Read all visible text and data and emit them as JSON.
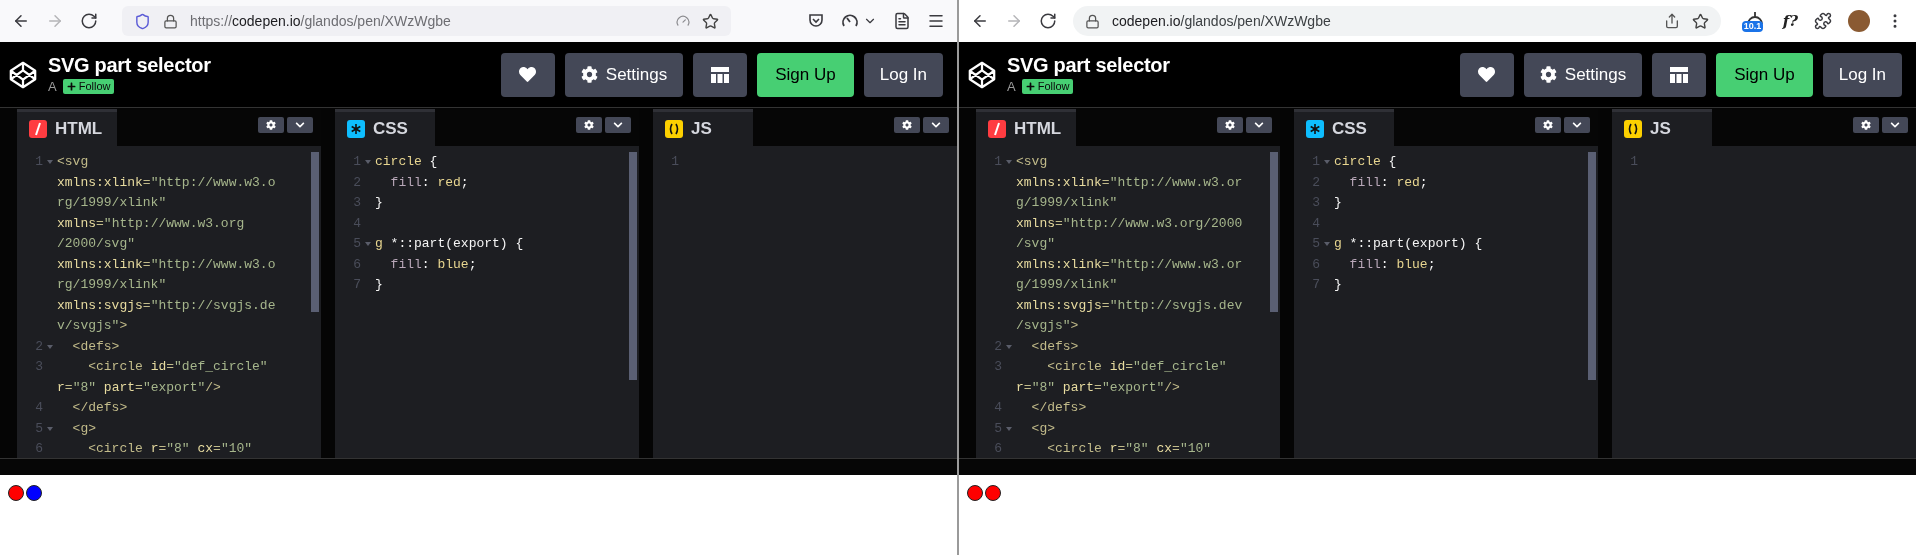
{
  "windows": [
    {
      "browser": {
        "kind": "firefox",
        "forward_disabled": true,
        "url": {
          "prefix": "https://",
          "host": "codepen.io",
          "path": "/glandos/pen/XWzWgbe"
        }
      },
      "pen": {
        "title": "SVG part selector",
        "author": "A",
        "follow": "Follow",
        "buttons": [
          {
            "kind": "heart"
          },
          {
            "kind": "settings",
            "label": "Settings"
          },
          {
            "kind": "layout"
          },
          {
            "kind": "signup",
            "label": "Sign Up"
          },
          {
            "kind": "login",
            "label": "Log In"
          }
        ]
      },
      "editors": [
        {
          "kind": "html",
          "label": "HTML",
          "lines": [
            {
              "n": "1",
              "fold": true,
              "seg": [
                {
                  "text": "<svg",
                  "kind": "t"
                }
              ]
            },
            {
              "seg": [
                {
                  "text": "xmlns:xlink",
                  "kind": "a"
                },
                {
                  "text": "=",
                  "kind": "t"
                },
                {
                  "text": "\"http://www.w3.o",
                  "kind": "s"
                }
              ]
            },
            {
              "seg": [
                {
                  "text": "rg/1999/xlink\"",
                  "kind": "s"
                }
              ]
            },
            {
              "seg": [
                {
                  "text": "xmlns",
                  "kind": "a"
                },
                {
                  "text": "=",
                  "kind": "t"
                },
                {
                  "text": "\"http://www.w3.org",
                  "kind": "s"
                }
              ]
            },
            {
              "seg": [
                {
                  "text": "/2000/svg\"",
                  "kind": "s"
                }
              ]
            },
            {
              "seg": [
                {
                  "text": "xmlns:xlink",
                  "kind": "a"
                },
                {
                  "text": "=",
                  "kind": "t"
                },
                {
                  "text": "\"http://www.w3.o",
                  "kind": "s"
                }
              ]
            },
            {
              "seg": [
                {
                  "text": "rg/1999/xlink\"",
                  "kind": "s"
                }
              ]
            },
            {
              "seg": [
                {
                  "text": "xmlns:svgjs",
                  "kind": "a"
                },
                {
                  "text": "=",
                  "kind": "t"
                },
                {
                  "text": "\"http://svgjs.de",
                  "kind": "s"
                }
              ]
            },
            {
              "seg": [
                {
                  "text": "v/svgjs\"",
                  "kind": "s"
                },
                {
                  "text": ">",
                  "kind": "t"
                }
              ]
            },
            {
              "n": "2",
              "fold": true,
              "seg": [
                {
                  "text": "  <defs>",
                  "kind": "t"
                }
              ]
            },
            {
              "n": "3",
              "fold": false,
              "seg": [
                {
                  "text": "    <circle ",
                  "kind": "t"
                },
                {
                  "text": "id",
                  "kind": "a"
                },
                {
                  "text": "=",
                  "kind": "t"
                },
                {
                  "text": "\"def_circle\"",
                  "kind": "s"
                }
              ]
            },
            {
              "seg": [
                {
                  "text": "r",
                  "kind": "a"
                },
                {
                  "text": "=",
                  "kind": "t"
                },
                {
                  "text": "\"8\" ",
                  "kind": "s"
                },
                {
                  "text": "part",
                  "kind": "a"
                },
                {
                  "text": "=",
                  "kind": "t"
                },
                {
                  "text": "\"export\"",
                  "kind": "s"
                },
                {
                  "text": "/>",
                  "kind": "t"
                }
              ]
            },
            {
              "n": "4",
              "fold": false,
              "seg": [
                {
                  "text": "  </defs>",
                  "kind": "t"
                }
              ]
            },
            {
              "n": "5",
              "fold": true,
              "seg": [
                {
                  "text": "  <g>",
                  "kind": "t"
                }
              ]
            },
            {
              "n": "6",
              "fold": false,
              "seg": [
                {
                  "text": "    <circle ",
                  "kind": "t"
                },
                {
                  "text": "r",
                  "kind": "a"
                },
                {
                  "text": "=",
                  "kind": "t"
                },
                {
                  "text": "\"8\" ",
                  "kind": "s"
                },
                {
                  "text": "cx",
                  "kind": "a"
                },
                {
                  "text": "=",
                  "kind": "t"
                },
                {
                  "text": "\"10\"",
                  "kind": "s"
                }
              ]
            }
          ]
        },
        {
          "kind": "css",
          "label": "CSS",
          "lines": [
            {
              "n": "1",
              "fold": true,
              "seg": [
                {
                  "text": "circle",
                  "kind": "sel"
                },
                {
                  "text": " {",
                  "kind": "p"
                }
              ]
            },
            {
              "n": "2",
              "fold": false,
              "seg": [
                {
                  "text": "  fill",
                  "kind": "prop"
                },
                {
                  "text": ": ",
                  "kind": "p"
                },
                {
                  "text": "red",
                  "kind": "val"
                },
                {
                  "text": ";",
                  "kind": "p"
                }
              ]
            },
            {
              "n": "3",
              "fold": false,
              "seg": [
                {
                  "text": "}",
                  "kind": "p"
                }
              ]
            },
            {
              "n": "4",
              "fold": false
            },
            {
              "n": "5",
              "fold": true,
              "seg": [
                {
                  "text": "g",
                  "kind": "sel"
                },
                {
                  "text": " *::part(export) {",
                  "kind": "p"
                }
              ]
            },
            {
              "n": "6",
              "fold": false,
              "seg": [
                {
                  "text": "  fill",
                  "kind": "prop"
                },
                {
                  "text": ": ",
                  "kind": "p"
                },
                {
                  "text": "blue",
                  "kind": "val"
                },
                {
                  "text": ";",
                  "kind": "p"
                }
              ]
            },
            {
              "n": "7",
              "fold": false,
              "seg": [
                {
                  "text": "}",
                  "kind": "p"
                }
              ]
            }
          ]
        },
        {
          "kind": "js",
          "label": "JS",
          "lines": [
            {
              "n": "1",
              "fold": false
            }
          ]
        }
      ],
      "preview": {
        "circles": [
          {
            "color": "#ff0000"
          },
          {
            "color": "#0000ff"
          }
        ]
      }
    },
    {
      "browser": {
        "kind": "chrome",
        "forward_disabled": true,
        "url": {
          "host": "codepen.io",
          "path": "/glandos/pen/XWzWgbe"
        },
        "extension_badge": "10.1",
        "extension_text": "f?"
      },
      "pen": {
        "title": "SVG part selector",
        "author": "A",
        "follow": "Follow",
        "buttons": [
          {
            "kind": "heart"
          },
          {
            "kind": "settings",
            "label": "Settings"
          },
          {
            "kind": "layout"
          },
          {
            "kind": "signup",
            "label": "Sign Up"
          },
          {
            "kind": "login",
            "label": "Log In"
          }
        ]
      },
      "editors": [
        {
          "kind": "html",
          "label": "HTML",
          "lines": [
            {
              "n": "1",
              "fold": true,
              "seg": [
                {
                  "text": "<svg",
                  "kind": "t"
                }
              ]
            },
            {
              "seg": [
                {
                  "text": "xmlns:xlink",
                  "kind": "a"
                },
                {
                  "text": "=",
                  "kind": "t"
                },
                {
                  "text": "\"http://www.w3.or",
                  "kind": "s"
                }
              ]
            },
            {
              "seg": [
                {
                  "text": "g/1999/xlink\"",
                  "kind": "s"
                }
              ]
            },
            {
              "seg": [
                {
                  "text": "xmlns",
                  "kind": "a"
                },
                {
                  "text": "=",
                  "kind": "t"
                },
                {
                  "text": "\"http://www.w3.org/2000",
                  "kind": "s"
                }
              ]
            },
            {
              "seg": [
                {
                  "text": "/svg\"",
                  "kind": "s"
                }
              ]
            },
            {
              "seg": [
                {
                  "text": "xmlns:xlink",
                  "kind": "a"
                },
                {
                  "text": "=",
                  "kind": "t"
                },
                {
                  "text": "\"http://www.w3.or",
                  "kind": "s"
                }
              ]
            },
            {
              "seg": [
                {
                  "text": "g/1999/xlink\"",
                  "kind": "s"
                }
              ]
            },
            {
              "seg": [
                {
                  "text": "xmlns:svgjs",
                  "kind": "a"
                },
                {
                  "text": "=",
                  "kind": "t"
                },
                {
                  "text": "\"http://svgjs.dev",
                  "kind": "s"
                }
              ]
            },
            {
              "seg": [
                {
                  "text": "/svgjs\"",
                  "kind": "s"
                },
                {
                  "text": ">",
                  "kind": "t"
                }
              ]
            },
            {
              "n": "2",
              "fold": true,
              "seg": [
                {
                  "text": "  <defs>",
                  "kind": "t"
                }
              ]
            },
            {
              "n": "3",
              "fold": false,
              "seg": [
                {
                  "text": "    <circle ",
                  "kind": "t"
                },
                {
                  "text": "id",
                  "kind": "a"
                },
                {
                  "text": "=",
                  "kind": "t"
                },
                {
                  "text": "\"def_circle\"",
                  "kind": "s"
                }
              ]
            },
            {
              "seg": [
                {
                  "text": "r",
                  "kind": "a"
                },
                {
                  "text": "=",
                  "kind": "t"
                },
                {
                  "text": "\"8\" ",
                  "kind": "s"
                },
                {
                  "text": "part",
                  "kind": "a"
                },
                {
                  "text": "=",
                  "kind": "t"
                },
                {
                  "text": "\"export\"",
                  "kind": "s"
                },
                {
                  "text": "/>",
                  "kind": "t"
                }
              ]
            },
            {
              "n": "4",
              "fold": false,
              "seg": [
                {
                  "text": "  </defs>",
                  "kind": "t"
                }
              ]
            },
            {
              "n": "5",
              "fold": true,
              "seg": [
                {
                  "text": "  <g>",
                  "kind": "t"
                }
              ]
            },
            {
              "n": "6",
              "fold": false,
              "seg": [
                {
                  "text": "    <circle ",
                  "kind": "t"
                },
                {
                  "text": "r",
                  "kind": "a"
                },
                {
                  "text": "=",
                  "kind": "t"
                },
                {
                  "text": "\"8\" ",
                  "kind": "s"
                },
                {
                  "text": "cx",
                  "kind": "a"
                },
                {
                  "text": "=",
                  "kind": "t"
                },
                {
                  "text": "\"10\"",
                  "kind": "s"
                }
              ]
            }
          ]
        },
        {
          "kind": "css",
          "label": "CSS",
          "lines": [
            {
              "n": "1",
              "fold": true,
              "seg": [
                {
                  "text": "circle",
                  "kind": "sel"
                },
                {
                  "text": " {",
                  "kind": "p"
                }
              ]
            },
            {
              "n": "2",
              "fold": false,
              "seg": [
                {
                  "text": "  fill",
                  "kind": "prop"
                },
                {
                  "text": ": ",
                  "kind": "p"
                },
                {
                  "text": "red",
                  "kind": "val"
                },
                {
                  "text": ";",
                  "kind": "p"
                }
              ]
            },
            {
              "n": "3",
              "fold": false,
              "seg": [
                {
                  "text": "}",
                  "kind": "p"
                }
              ]
            },
            {
              "n": "4",
              "fold": false
            },
            {
              "n": "5",
              "fold": true,
              "seg": [
                {
                  "text": "g",
                  "kind": "sel"
                },
                {
                  "text": " *::part(export) {",
                  "kind": "p"
                }
              ]
            },
            {
              "n": "6",
              "fold": false,
              "seg": [
                {
                  "text": "  fill",
                  "kind": "prop"
                },
                {
                  "text": ": ",
                  "kind": "p"
                },
                {
                  "text": "blue",
                  "kind": "val"
                },
                {
                  "text": ";",
                  "kind": "p"
                }
              ]
            },
            {
              "n": "7",
              "fold": false,
              "seg": [
                {
                  "text": "}",
                  "kind": "p"
                }
              ]
            }
          ]
        },
        {
          "kind": "js",
          "label": "JS",
          "lines": [
            {
              "n": "1",
              "fold": false
            }
          ]
        }
      ],
      "preview": {
        "circles": [
          {
            "color": "#ff0000"
          },
          {
            "color": "#ff0000"
          }
        ]
      }
    }
  ]
}
